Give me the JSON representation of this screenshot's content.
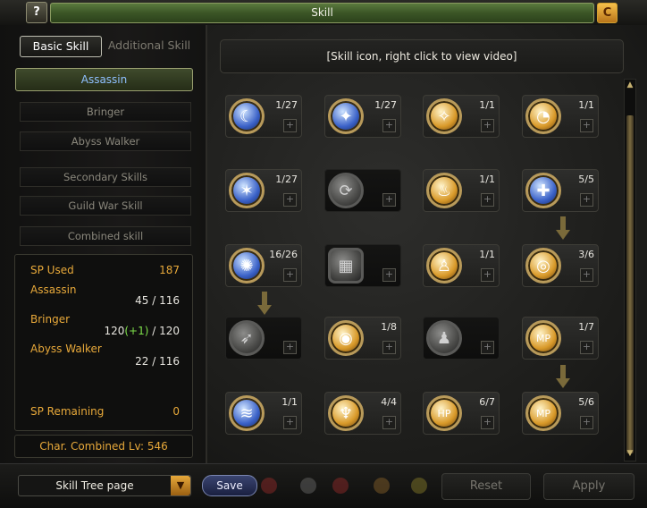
{
  "window": {
    "title": "Skill",
    "help_label": "?",
    "close_label": "C"
  },
  "left": {
    "tabs": [
      {
        "label": "Basic Skill",
        "active": true
      },
      {
        "label": "Additional Skill",
        "active": false
      }
    ],
    "classes": [
      {
        "label": "Assassin",
        "selected": true
      },
      {
        "label": "Bringer"
      },
      {
        "label": "Abyss Walker"
      },
      {
        "label": "Secondary Skills"
      },
      {
        "label": "Guild War Skill"
      },
      {
        "label": "Combined skill"
      }
    ],
    "sp": {
      "used_label": "SP Used",
      "used_value": "187",
      "assassin_label": "Assassin",
      "assassin_value": "45 / 116",
      "bringer_label": "Bringer",
      "bringer_base": "120",
      "bringer_bonus": "(+1)",
      "bringer_max": " / 120",
      "abyss_label": "Abyss Walker",
      "abyss_value": "22 / 116",
      "remaining_label": "SP Remaining",
      "remaining_value": "0"
    },
    "char_level": "Char. Combined Lv: 546"
  },
  "main": {
    "header": "[Skill icon, right click to view video]",
    "plus_label": "+",
    "skills": [
      {
        "level": "1/27",
        "style": "blue",
        "glyph": "☾"
      },
      {
        "level": "1/27",
        "style": "blue",
        "glyph": "✦"
      },
      {
        "level": "1/1",
        "style": "gold",
        "glyph": "✧"
      },
      {
        "level": "1/1",
        "style": "gold",
        "glyph": "◔"
      },
      {
        "level": "1/27",
        "style": "blue",
        "glyph": "✶"
      },
      {
        "level": "",
        "style": "gray",
        "glyph": "⟳"
      },
      {
        "level": "1/1",
        "style": "gold",
        "glyph": "♨"
      },
      {
        "level": "5/5",
        "style": "blue",
        "glyph": "✚"
      },
      {
        "level": "16/26",
        "style": "blue",
        "glyph": "✺"
      },
      {
        "level": "",
        "style": "gray-square",
        "glyph": "▦"
      },
      {
        "level": "1/1",
        "style": "gold",
        "glyph": "♙"
      },
      {
        "level": "3/6",
        "style": "gold",
        "glyph": "◎"
      },
      {
        "level": "",
        "style": "gray",
        "glyph": "➶"
      },
      {
        "level": "1/8",
        "style": "gold",
        "glyph": "◉"
      },
      {
        "level": "",
        "style": "gray",
        "glyph": "♟"
      },
      {
        "level": "1/7",
        "style": "gold",
        "glyph": "MP"
      },
      {
        "level": "1/1",
        "style": "blue",
        "glyph": "≋"
      },
      {
        "level": "4/4",
        "style": "gold",
        "glyph": "♆"
      },
      {
        "level": "6/7",
        "style": "gold",
        "glyph": "HP"
      },
      {
        "level": "5/6",
        "style": "gold",
        "glyph": "MP"
      }
    ]
  },
  "bottom": {
    "tree_select": "Skill Tree page",
    "save_label": "Save",
    "reset_label": "Reset",
    "apply_label": "Apply"
  }
}
